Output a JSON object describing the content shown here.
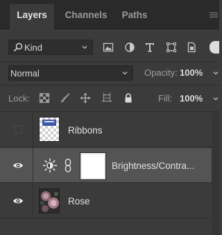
{
  "tabs": [
    {
      "label": "Layers",
      "active": true
    },
    {
      "label": "Channels",
      "active": false
    },
    {
      "label": "Paths",
      "active": false
    }
  ],
  "filter": {
    "kind_label": "Kind",
    "icons": [
      "pixel-layer-filter-icon",
      "adjustment-layer-filter-icon",
      "type-layer-filter-icon",
      "shape-layer-filter-icon",
      "smart-object-filter-icon"
    ]
  },
  "blend": {
    "mode": "Normal",
    "opacity_label": "Opacity:",
    "opacity_value": "100%"
  },
  "lock": {
    "label": "Lock:",
    "icons": [
      "lock-transparent-pixels-icon",
      "lock-image-pixels-icon",
      "lock-position-icon",
      "lock-artboard-icon",
      "lock-all-icon"
    ],
    "fill_label": "Fill:",
    "fill_value": "100%"
  },
  "layers": [
    {
      "name": "Ribbons",
      "visible": false,
      "selected": false,
      "kind": "pixel"
    },
    {
      "name": "Brightness/Contra...",
      "visible": true,
      "selected": true,
      "kind": "adjustment"
    },
    {
      "name": "Rose",
      "visible": true,
      "selected": false,
      "kind": "pixel"
    }
  ],
  "colors": {
    "panel_bg": "#3b3b3b",
    "tab_bar_bg": "#2a2a2a",
    "selected_row": "#545454",
    "text": "#e2e2e2"
  }
}
